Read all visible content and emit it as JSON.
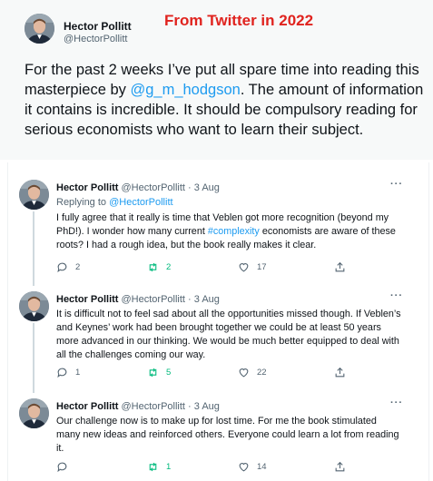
{
  "caption": "From Twitter in 2022",
  "main_tweet": {
    "name": "Hector Pollitt",
    "handle": "@HectorPollitt",
    "text_before": "For the past 2 weeks I’ve put all spare time into reading this masterpiece by ",
    "mention": "@g_m_hodgson",
    "text_after": ". The amount of information it contains is incredible. It should be compulsory reading for serious economists who want to learn their subject."
  },
  "replies": [
    {
      "name": "Hector Pollitt",
      "meta": "@HectorPollitt · 3 Aug",
      "replying_label": "Replying to ",
      "replying_to": "@HectorPollitt",
      "text_before": "I fully agree that it really is time that Veblen got more recognition (beyond my PhD!). I wonder how many current ",
      "hashtag": "#complexity",
      "text_after": " economists are aware of these roots? I had a rough idea, but the book really makes it clear.",
      "replies_count": "2",
      "retweets_count": "2",
      "likes_count": "17"
    },
    {
      "name": "Hector Pollitt",
      "meta": "@HectorPollitt · 3 Aug",
      "text": "It is difficult not to feel sad about all the opportunities missed though. If Veblen’s and Keynes’ work had been brought together we could be at least 50 years more advanced in our thinking. We would be much better equipped to deal with all the challenges coming our way.",
      "replies_count": "1",
      "retweets_count": "5",
      "likes_count": "22"
    },
    {
      "name": "Hector Pollitt",
      "meta": "@HectorPollitt · 3 Aug",
      "text": "Our challenge now is to make up for lost time. For me the book stimulated many new ideas and reinforced others. Everyone could learn a lot from reading it.",
      "replies_count": "",
      "retweets_count": "1",
      "likes_count": "14"
    }
  ],
  "more_label": "···",
  "icons": {
    "reply": "reply-icon",
    "retweet": "retweet-icon",
    "like": "heart-icon",
    "share": "share-icon"
  },
  "colors": {
    "link": "#1d9bf0",
    "retweet_active": "#00ba7c",
    "caption": "#e0231e",
    "muted": "#536471"
  }
}
